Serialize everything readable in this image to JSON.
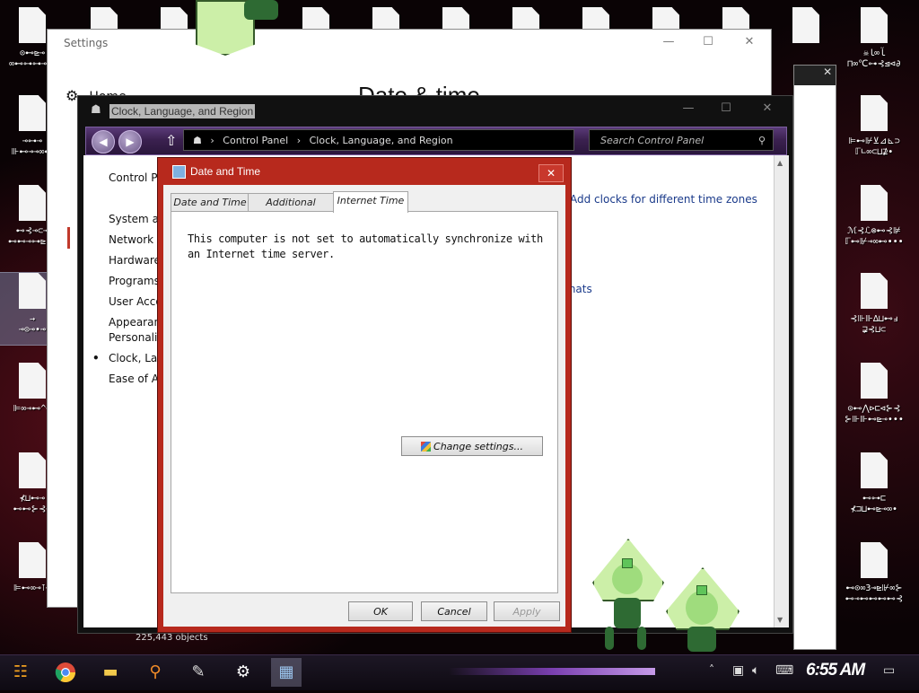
{
  "desktop": {
    "right_icons": [
      {
        "label": "☠ﺂ∞ﺎ\n⊓∞℃⊶⊰⊴⊲∂"
      },
      {
        "label": "⊫⊷⊮⊻⊿⊾⊃\nℾ∟∞⊂⊔⊉∙"
      },
      {
        "label": "ℳ⊰ℒ⊗⊷⊰⊯\nℾ⊷⊮⊸∞⊷∙∙∙"
      },
      {
        "label": "⊰⊪⊪∆⊔⊷ⅎ\n⋥⊰⊔⊂"
      },
      {
        "label": "⊙⊷⋀⊳⊏⊲⊱⊰\n⊱⊪⊪⊷⊵⊸∙∙∙"
      },
      {
        "label": "⊷⊶⊏\n⊀⊐⊔⊷⊵⊸∞∙"
      },
      {
        "label": "⊷⊙∞3⊸⊵⊮∞⊱\n⊷⊸⊷⊷⊷⊷⊰"
      }
    ],
    "left_icons": [
      {
        "label": "⊙⊷⊵⊸\n∞⊷⊶⊶⊸⊷"
      },
      {
        "label": "⊸⊶⊸\n⊪⊷⊸⊸∞⊷"
      },
      {
        "label": "⊷⊰⊸⊂⊸\n⊷⊷⊸⊶⊵∙∙"
      },
      {
        "label": "→\n⊸⊙⊸∙⊸"
      },
      {
        "label": "⊫∞⊸⊷^⊸"
      },
      {
        "label": "⊀⊔⊷⊸\n⊷⊷⊱⊰⊸"
      },
      {
        "label": "⊫⊷∞⊸⊺⊸"
      }
    ]
  },
  "settings": {
    "title": "Settings",
    "home": "Home",
    "heading": "Date & time",
    "min": "—",
    "max": "☐",
    "close": "✕"
  },
  "control_panel": {
    "title": "Clock, Language, and Region",
    "breadcrumb": [
      "Control Panel",
      "Clock, Language, and Region"
    ],
    "search_placeholder": "Search Control Panel",
    "left_items": [
      "Control Pa",
      "",
      "System an",
      "Network a",
      "Hardware",
      "Programs",
      "User Acco",
      "Appearanc",
      "Personaliz",
      "Clock, Lan",
      "Ease of A"
    ],
    "link_add_clocks": "Add clocks for different time zones",
    "link_formats": "rmats",
    "status": "225,443 objects"
  },
  "dialog": {
    "title": "Date and Time",
    "tabs": [
      "Date and Time",
      "Additional Clocks",
      "Internet Time"
    ],
    "active_tab": "Internet Time",
    "message": "This computer is not set to automatically synchronize with an Internet time server.",
    "change_settings": "Change settings...",
    "ok": "OK",
    "cancel": "Cancel",
    "apply": "Apply"
  },
  "taskbar": {
    "clock": "6:55 AM",
    "apps": [
      "start",
      "chrome",
      "file-explorer",
      "search",
      "photo-app",
      "settings",
      "control-panel"
    ]
  },
  "colors": {
    "dialog_frame": "#b7291d",
    "nav_purple": "#3b2150",
    "link_blue": "#1a3a8a"
  }
}
